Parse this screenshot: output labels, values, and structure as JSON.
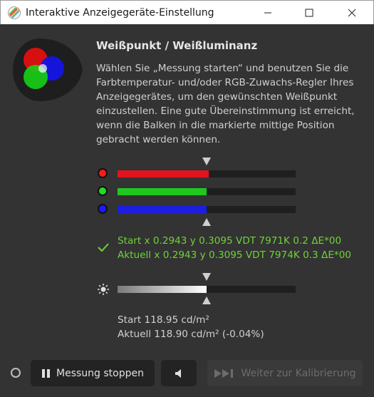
{
  "window": {
    "title": "Interaktive Anzeigegeräte-Einstellung",
    "controls": [
      "minimize",
      "maximize",
      "close"
    ]
  },
  "content": {
    "heading": "Weißpunkt / Weißluminanz",
    "description": "Wählen Sie „Messung starten“ und benutzen Sie die Farbtemperatur- und/oder RGB-Zuwachs-Regler Ihres Anzeigegerätes, um den gewünschten Weißpunkt einzustellen. Eine gute Übereinstimmung ist erreicht, wenn die Balken in die markierte mittige Position gebracht werden können."
  },
  "rgb_bars": [
    {
      "channel": "red",
      "color": "#e0141e",
      "dot_color": "#ff1a1a",
      "level": 0.51
    },
    {
      "channel": "green",
      "color": "#1ec81e",
      "dot_color": "#1fe01f",
      "level": 0.5
    },
    {
      "channel": "blue",
      "color": "#1e1ee0",
      "dot_color": "#1a1aff",
      "level": 0.5
    }
  ],
  "target_level": 0.5,
  "measurement": {
    "start": "Start x 0.2943 y 0.3095 VDT 7971K 0.2 ΔE*00",
    "current": "Aktuell x 0.2943 y 0.3095 VDT 7974K 0.3 ΔE*00",
    "status_icon": "checkmark-icon",
    "status_color": "#6fd23a"
  },
  "luminance": {
    "level": 0.5,
    "start": "Start 118.95 cd/m²",
    "current": "Aktuell 118.90 cd/m² (-0.04%)"
  },
  "buttons": {
    "stop": "Messung stoppen",
    "next": "Weiter zur Kalibrierung"
  }
}
